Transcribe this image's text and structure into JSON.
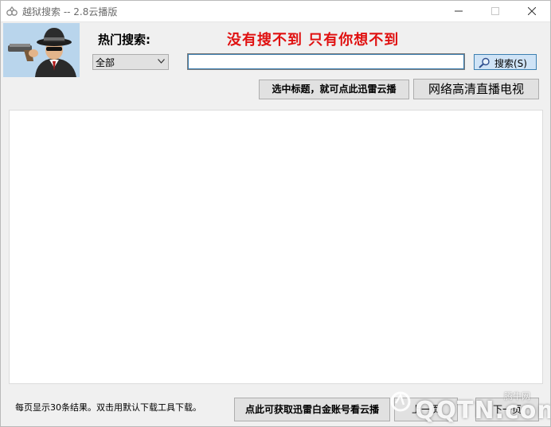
{
  "window": {
    "title": "越狱搜索 -- 2.8云播版"
  },
  "header": {
    "hot_search_label": "热门搜索:",
    "slogan": "没有搜不到  只有你想不到",
    "category_select": {
      "selected": "全部"
    },
    "search": {
      "value": "",
      "button_label": "搜索(S)"
    }
  },
  "buttons": {
    "xunlei_title": "选中标题，就可点此迅雷云播",
    "live_tv": "网络高清直播电视",
    "get_account": "点此可获取迅雷白金账号看云播",
    "prev_page": "上一页",
    "next_page": "下一页"
  },
  "footer": {
    "info": "每页显示30条结果。双击用默认下载工具下载。"
  },
  "watermark": {
    "brand": "QQTN.com",
    "sub": "腾牛网"
  },
  "colors": {
    "slogan": "#e01010",
    "logo_bg": "#b9d5ec",
    "search_button_bg": "#cfe3f6"
  }
}
